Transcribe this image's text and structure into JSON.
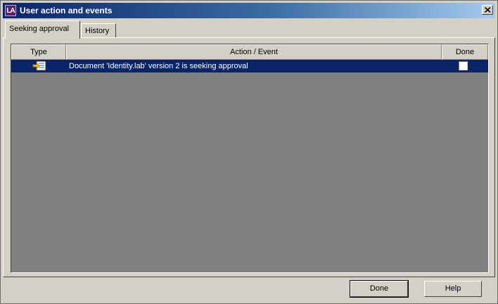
{
  "window": {
    "icon_text": "LA",
    "title": "User action and events"
  },
  "tabs": [
    {
      "label": "Seeking approval",
      "active": true
    },
    {
      "label": "History",
      "active": false
    }
  ],
  "grid": {
    "columns": [
      "Type",
      "Action / Event",
      "Done"
    ],
    "rows": [
      {
        "type_icon": "document-arrow-icon",
        "action": "Document 'Identity.lab' version 2 is seeking approval",
        "done": false,
        "selected": true
      }
    ]
  },
  "buttons": {
    "done_label": "Done",
    "help_label": "Help"
  },
  "colors": {
    "selection": "#0a246a",
    "grid_background": "#808080",
    "dialog_face": "#d4d0c8"
  }
}
